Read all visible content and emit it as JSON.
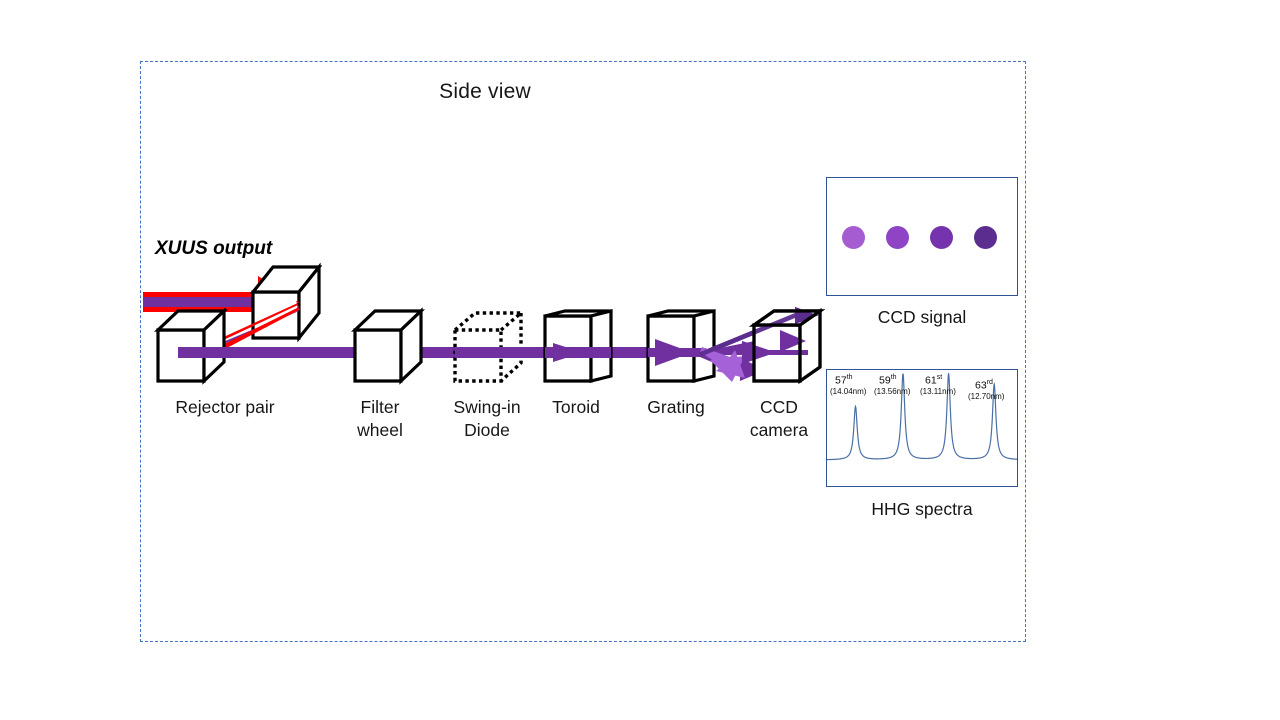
{
  "figure": {
    "title": "Side view",
    "source_label": "XUUS output"
  },
  "beamline": {
    "elements": [
      {
        "name": "rejector-pair",
        "label_line1": "Rejector pair",
        "label_line2": ""
      },
      {
        "name": "filter-wheel",
        "label_line1": "Filter",
        "label_line2": "wheel"
      },
      {
        "name": "swing-in-diode",
        "label_line1": "Swing-in",
        "label_line2": "Diode"
      },
      {
        "name": "toroid",
        "label_line1": "Toroid",
        "label_line2": ""
      },
      {
        "name": "grating",
        "label_line1": "Grating",
        "label_line2": ""
      },
      {
        "name": "ccd-camera",
        "label_line1": "CCD",
        "label_line2": "camera"
      }
    ]
  },
  "ccd_panel": {
    "caption": "CCD signal",
    "dots": [
      {
        "color": "#a45cd0"
      },
      {
        "color": "#8e44c4"
      },
      {
        "color": "#7633ae"
      },
      {
        "color": "#5b2d8e"
      }
    ]
  },
  "chart_data": {
    "type": "line",
    "title": "HHG spectra",
    "xlabel": "",
    "ylabel": "",
    "grid": false,
    "legend": "none",
    "line_color": "#4a6fa5",
    "annotations": [
      {
        "order": "57",
        "ordinal": "th",
        "wavelength": "(14.04nm)"
      },
      {
        "order": "59",
        "ordinal": "th",
        "wavelength": "(13.56nm)"
      },
      {
        "order": "61",
        "ordinal": "st",
        "wavelength": "(13.11nm)"
      },
      {
        "order": "63",
        "ordinal": "rd",
        "wavelength": "(12.70nm)"
      }
    ],
    "peaks": [
      {
        "harmonic": 57,
        "wavelength_nm": 14.04,
        "center_x": 0.15,
        "height": 0.62
      },
      {
        "harmonic": 59,
        "wavelength_nm": 13.56,
        "center_x": 0.4,
        "height": 1.0
      },
      {
        "harmonic": 61,
        "wavelength_nm": 13.11,
        "center_x": 0.64,
        "height": 1.0
      },
      {
        "harmonic": 63,
        "wavelength_nm": 12.7,
        "center_x": 0.88,
        "height": 0.88
      }
    ]
  },
  "colors": {
    "beam_purple": "#7030a0",
    "beam_purple_light": "#a561d8",
    "beam_red": "#ff0000",
    "frame_blue": "#4472c4",
    "panel_border": "#2f5496"
  }
}
